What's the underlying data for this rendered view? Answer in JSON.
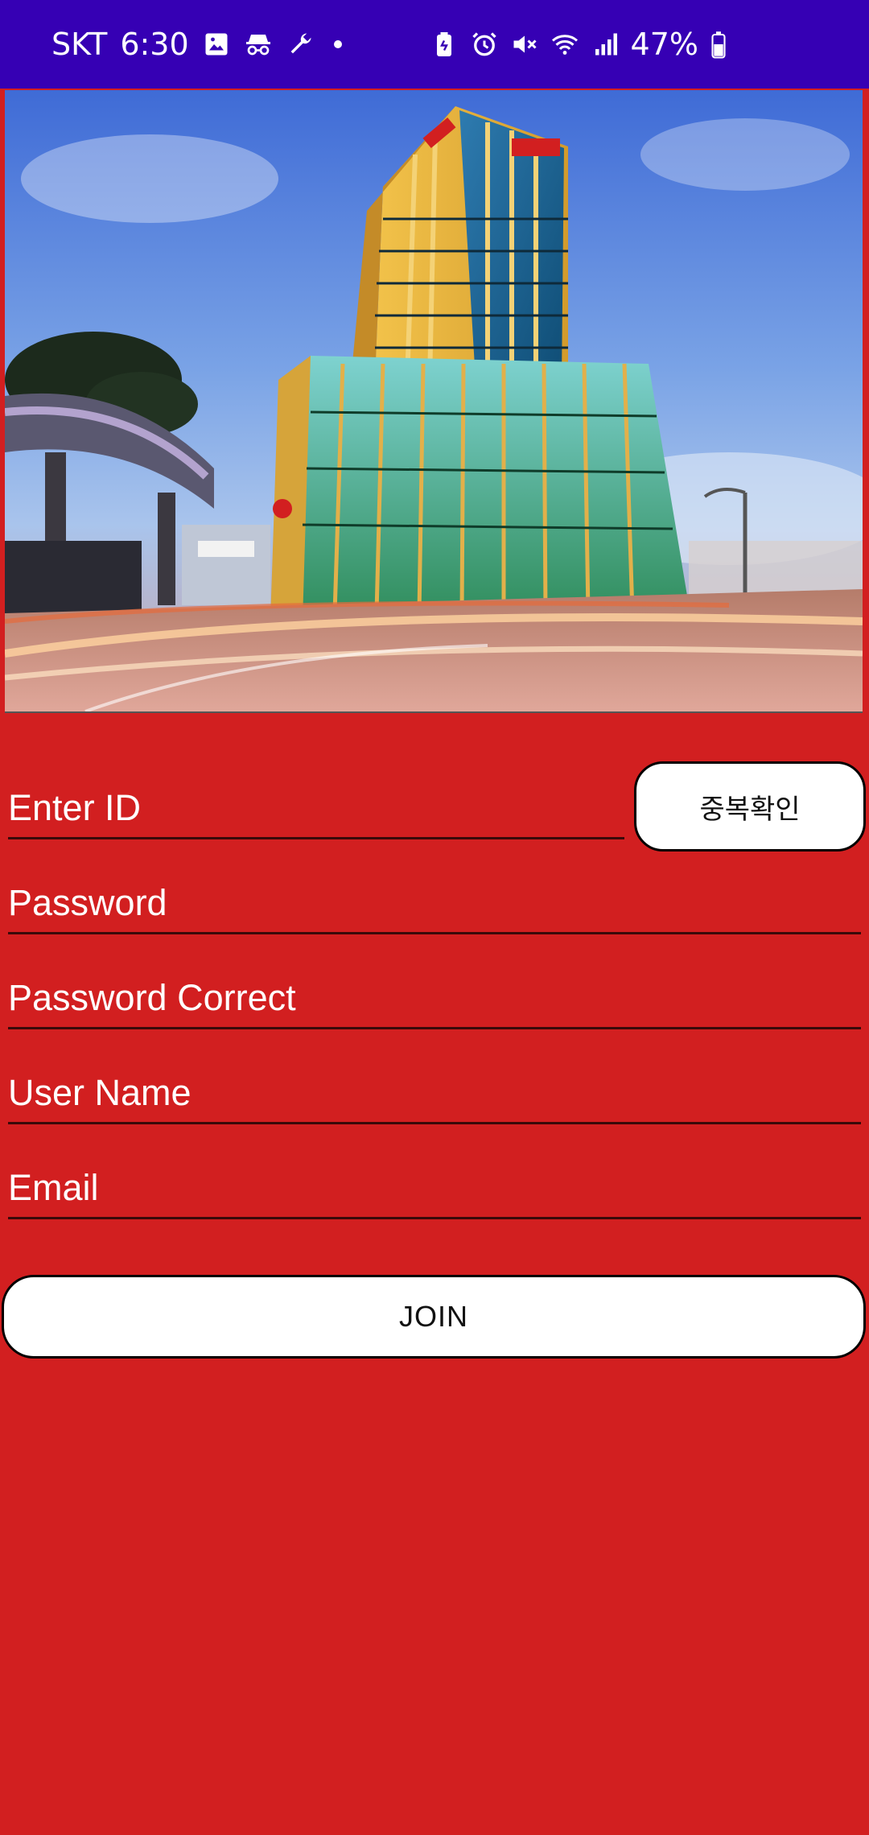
{
  "status_bar": {
    "carrier": "SKT",
    "time": "6:30",
    "battery": "47%",
    "left_icons": [
      "image-icon",
      "incognito-icon",
      "wrench-icon",
      "dot-icon"
    ],
    "right_icons": [
      "battery-saver-icon",
      "alarm-icon",
      "mute-icon",
      "wifi-icon",
      "signal-icon",
      "battery-icon"
    ],
    "background": "#3600b4"
  },
  "hero": {
    "image": "hotel-building-photo"
  },
  "form": {
    "id_placeholder": "Enter ID",
    "duplicate_check_label": "중복확인",
    "password_placeholder": "Password",
    "password_confirm_placeholder": "Password Correct",
    "username_placeholder": "User Name",
    "email_placeholder": "Email",
    "join_label": "JOIN"
  },
  "colors": {
    "background": "#d21f20",
    "button_bg": "#ffffff",
    "field_underline": "#3a0a0a"
  }
}
